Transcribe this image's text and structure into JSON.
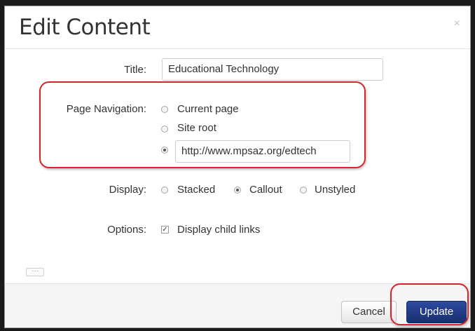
{
  "dialog": {
    "title": "Edit Content",
    "close_label": "×"
  },
  "form": {
    "title_label": "Title:",
    "title_value": "Educational Technology",
    "nav_label": "Page Navigation:",
    "nav_options": [
      "Current page",
      "Site root"
    ],
    "nav_url_value": "http://www.mpsaz.org/edtech",
    "nav_selected": "url",
    "display_label": "Display:",
    "display_options": [
      "Stacked",
      "Callout",
      "Unstyled"
    ],
    "display_selected": "Callout",
    "options_label": "Options:",
    "child_links_label": "Display child links",
    "child_links_checked": true
  },
  "footer": {
    "ellipsis_label": "···",
    "cancel_label": "Cancel",
    "update_label": "Update"
  },
  "colors": {
    "annotation": "#d8232a",
    "primary_button": "#1a2f6e"
  }
}
